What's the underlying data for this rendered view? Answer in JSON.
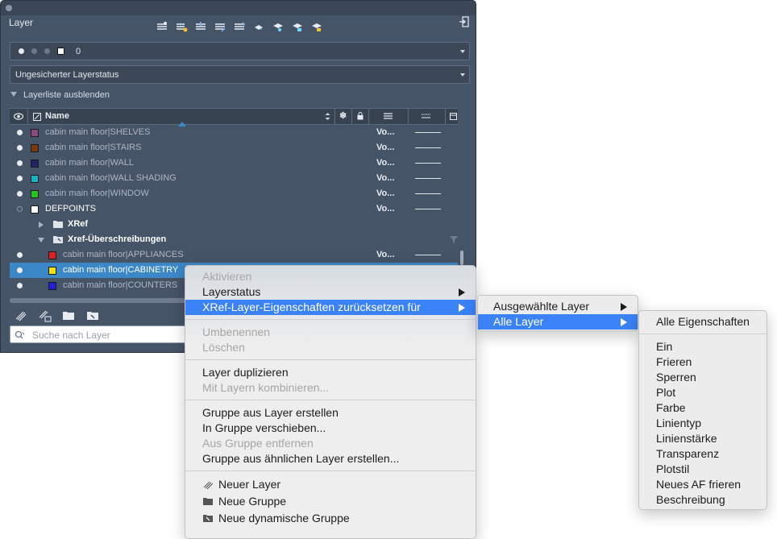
{
  "palette": {
    "title": "Layer",
    "current_layer": "0",
    "layer_state": "Ungesicherter Layerstatus",
    "hide_list_label": "Layerliste ausblenden",
    "column_name": "Name",
    "search_placeholder": "Suche nach Layer",
    "rows": [
      {
        "name": "cabin main floor|SHELVES",
        "color": "#8a4a82",
        "vo": "Vo...",
        "kind": "layer",
        "dim": true
      },
      {
        "name": "cabin main floor|STAIRS",
        "color": "#7a3a12",
        "vo": "Vo...",
        "kind": "layer",
        "dim": true
      },
      {
        "name": "cabin main floor|WALL",
        "color": "#22226a",
        "vo": "Vo...",
        "kind": "layer",
        "dim": true
      },
      {
        "name": "cabin main floor|WALL SHADING",
        "color": "#16b6c8",
        "vo": "Vo...",
        "kind": "layer",
        "dim": true
      },
      {
        "name": "cabin main floor|WINDOW",
        "color": "#1ec81e",
        "vo": "Vo...",
        "kind": "layer",
        "dim": true
      },
      {
        "name": "DEFPOINTS",
        "color": "#ffffff",
        "vo": "Vo...",
        "kind": "layer",
        "dim": false
      },
      {
        "name": "XRef",
        "kind": "group"
      },
      {
        "name": "Xref-Überschreibungen",
        "kind": "group"
      },
      {
        "name": "cabin main floor|APPLIANCES",
        "color": "#e02020",
        "vo": "Vo...",
        "kind": "layer",
        "dim": true
      },
      {
        "name": "cabin main floor|CABINETRY",
        "color": "#f0e400",
        "vo": "",
        "kind": "layer",
        "selected": true
      },
      {
        "name": "cabin main floor|COUNTERS",
        "color": "#2020d8",
        "vo": "",
        "kind": "layer",
        "dim": true
      }
    ]
  },
  "context_menu": {
    "aktivieren": "Aktivieren",
    "layerstatus": "Layerstatus",
    "xref_reset": "XRef-Layer-Eigenschaften zurücksetzen für",
    "umbenennen": "Umbenennen",
    "loeschen": "Löschen",
    "duplizieren": "Layer duplizieren",
    "kombinieren": "Mit Layern kombinieren...",
    "gruppe_erstellen": "Gruppe aus Layer erstellen",
    "in_gruppe": "In Gruppe verschieben...",
    "aus_gruppe": "Aus Gruppe entfernen",
    "aehnliche": "Gruppe aus ähnlichen Layer erstellen...",
    "neuer_layer": "Neuer Layer",
    "neue_gruppe": "Neue Gruppe",
    "neue_dyn_gruppe": "Neue dynamische Gruppe"
  },
  "submenu": {
    "ausgewaehlte": "Ausgewählte Layer",
    "alle": "Alle Layer"
  },
  "properties_menu": {
    "items": [
      "Alle Eigenschaften",
      "Ein",
      "Frieren",
      "Sperren",
      "Plot",
      "Farbe",
      "Linientyp",
      "Linienstärke",
      "Transparenz",
      "Plotstil",
      "Neues AF frieren",
      "Beschreibung"
    ]
  },
  "colors": {
    "highlight": "#3a82f6",
    "selection_row": "#3b87c8",
    "palette_bg": "#465468"
  }
}
